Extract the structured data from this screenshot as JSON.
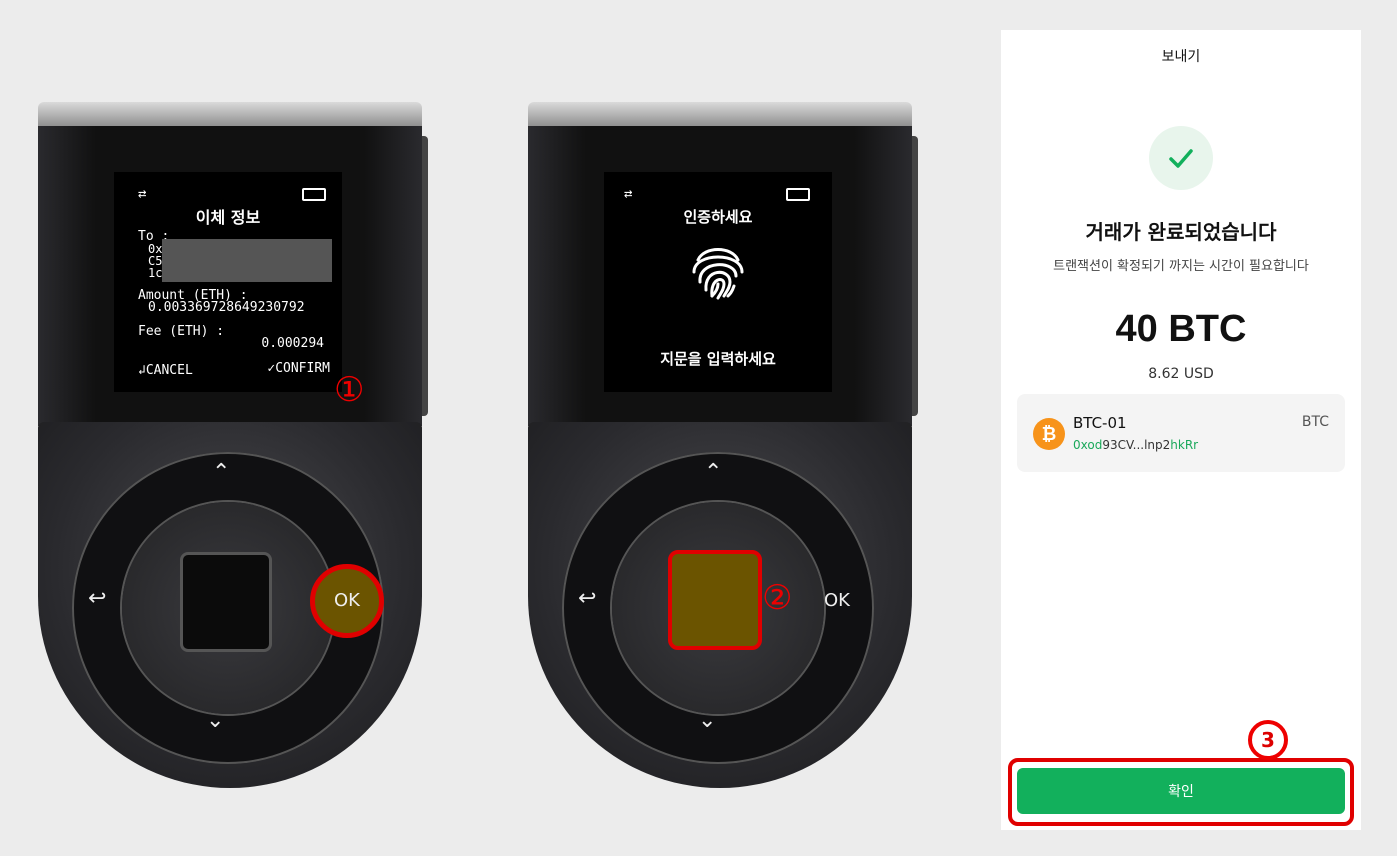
{
  "device1": {
    "screen_title": "이체 정보",
    "to_label": "To :",
    "to_prefix": [
      "0x",
      "C5",
      "1c"
    ],
    "amount_label": "Amount (ETH) :",
    "amount_value": "0.003369728649230792",
    "fee_label": "Fee (ETH) :",
    "fee_value": "0.000294",
    "cancel_label": "↲CANCEL",
    "confirm_label": "✓CONFIRM",
    "ok_label": "OK",
    "step_mark": "①"
  },
  "device2": {
    "screen_title": "인증하세요",
    "screen_footer": "지문을 입력하세요",
    "ok_label": "OK",
    "step_mark": "②"
  },
  "phone": {
    "title": "보내기",
    "headline": "거래가 완료되었습니다",
    "subtext": "트랜잭션이 확정되기 까지는 시간이 필요합니다",
    "amount": "40 BTC",
    "fiat": "8.62 USD",
    "account": {
      "name": "BTC-01",
      "ticker": "BTC",
      "addr_start": "0xod",
      "addr_mid": "93CV...lnp2",
      "addr_end": "hkRr",
      "coin_symbol": "₿"
    },
    "confirm_button": "확인",
    "step_mark": "3"
  },
  "colors": {
    "accent_green": "#12b05c",
    "highlight_red": "#e00000",
    "coin_orange": "#f7931a"
  }
}
